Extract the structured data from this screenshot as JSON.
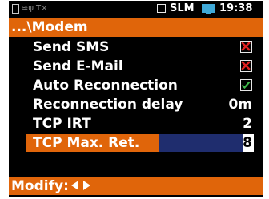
{
  "status_bar": {
    "sd_icon": "sd-card-icon",
    "signal_icon": "signal-strength-icon",
    "transmit_icon": "transmit-icon",
    "mode_box_icon": "mode-square-icon",
    "mode": "SLM",
    "battery_icon": "battery-icon",
    "clock": "19:38",
    "battery_color": "#3fa9d8"
  },
  "header": {
    "title": "...\\Modem",
    "color": "#e0650a"
  },
  "rows": [
    {
      "label": "Send SMS",
      "type": "checkbox",
      "checked": false,
      "value": "×"
    },
    {
      "label": "Send E-Mail",
      "type": "checkbox",
      "checked": false,
      "value": "×"
    },
    {
      "label": "Auto Reconnection",
      "type": "checkbox",
      "checked": true,
      "value": "✓"
    },
    {
      "label": "Reconnection delay",
      "type": "value",
      "value": "0m"
    },
    {
      "label": "TCP IRT",
      "type": "value",
      "value": "2"
    },
    {
      "label": "TCP Max. Ret.",
      "type": "value",
      "value": "8",
      "selected": true
    }
  ],
  "footer": {
    "label": "Modify:",
    "left_arrow_icon": "arrow-left-icon",
    "right_arrow_icon": "arrow-right-icon"
  },
  "colors": {
    "accent": "#e0650a",
    "selection_value_bg": "#1f2d6e",
    "cross": "#e02020",
    "check": "#3fb84a"
  }
}
